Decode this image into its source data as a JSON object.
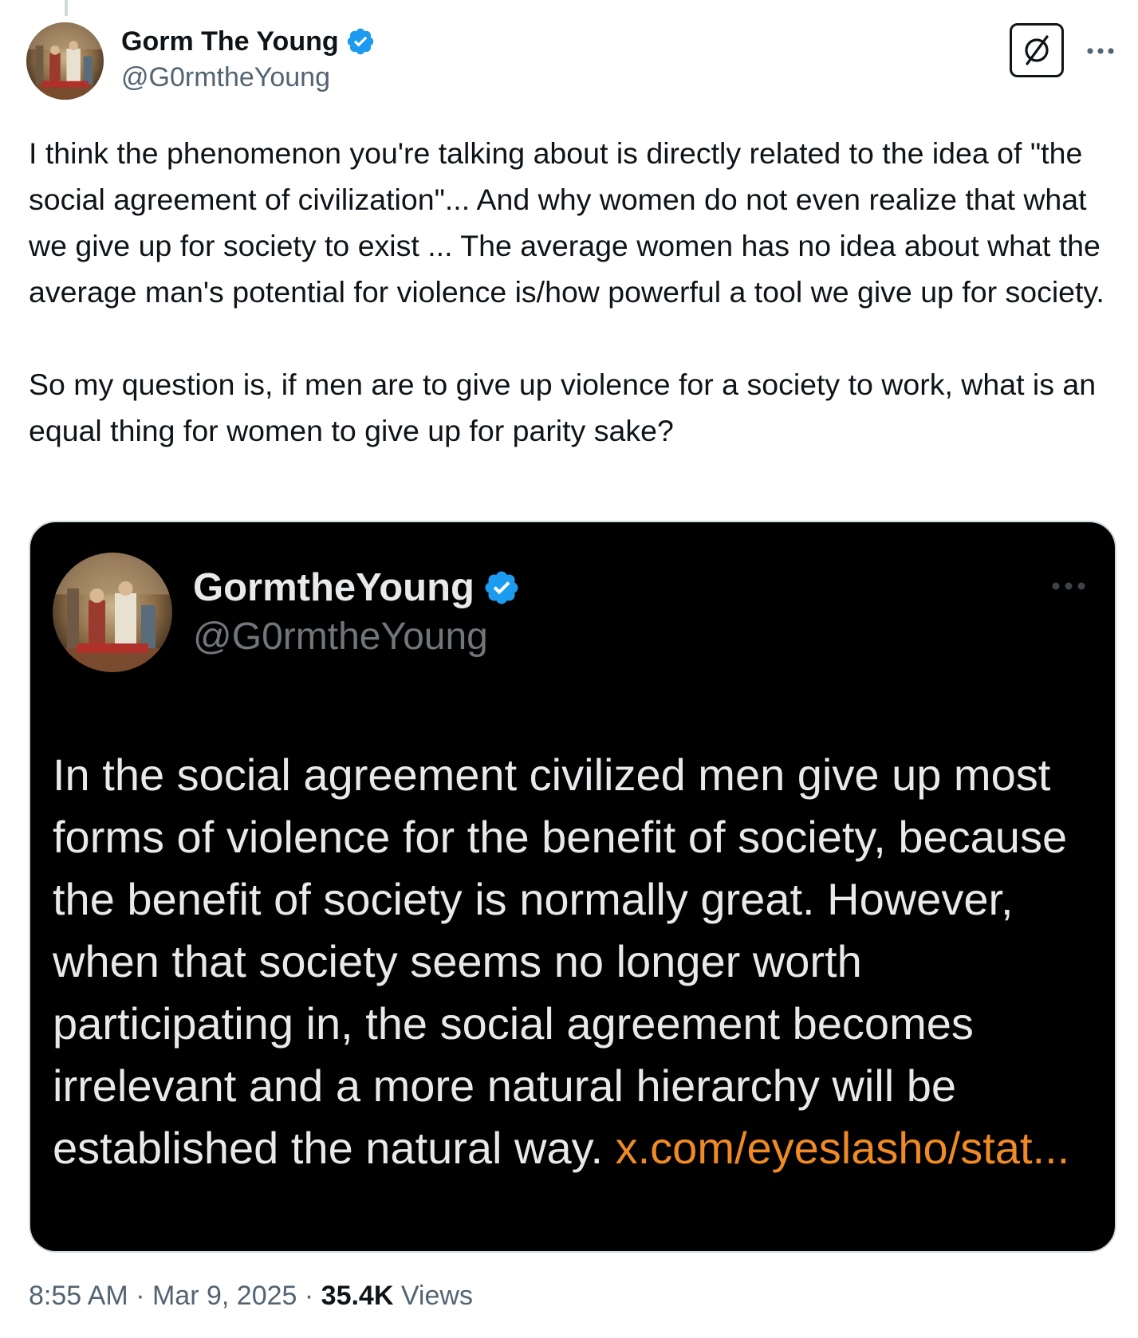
{
  "tweet": {
    "author": {
      "display_name": "Gorm The Young",
      "handle": "@G0rmtheYoung",
      "verified": true
    },
    "paragraphs": [
      "I think the phenomenon you're talking about is directly related to the idea of \"the social agreement of civilization\"... And why women do not even realize that what we give up for society to exist ... The average women has no idea about what the average man's potential for violence is/how powerful a tool we give up for society.",
      "So my question is, if men are to give up violence for a society to work, what is an equal thing for women to give up for parity sake?"
    ],
    "time": "8:55 AM",
    "date": "Mar 9, 2025",
    "separator": "·",
    "views_count": "35.4K",
    "views_label": "Views"
  },
  "quote": {
    "display_name": "GormtheYoung",
    "handle": "@G0rmtheYoung",
    "verified": true,
    "text": "In the social agreement civilized men give up most forms of violence for the benefit of society, because the benefit of society is normally great. However, when that society seems no longer worth participating in, the social agreement becomes irrelevant and a more natural hierarchy will be established the natural way. ",
    "link": "x.com/eyeslasho/stat..."
  },
  "icons": {
    "verified": "verified-badge-icon",
    "grok": "grok-icon",
    "more": "more-options-icon"
  },
  "colors": {
    "verified_blue": "#1d9bf0",
    "link_orange": "#f08a24",
    "quote_background": "#000000",
    "secondary_text": "#536471"
  }
}
